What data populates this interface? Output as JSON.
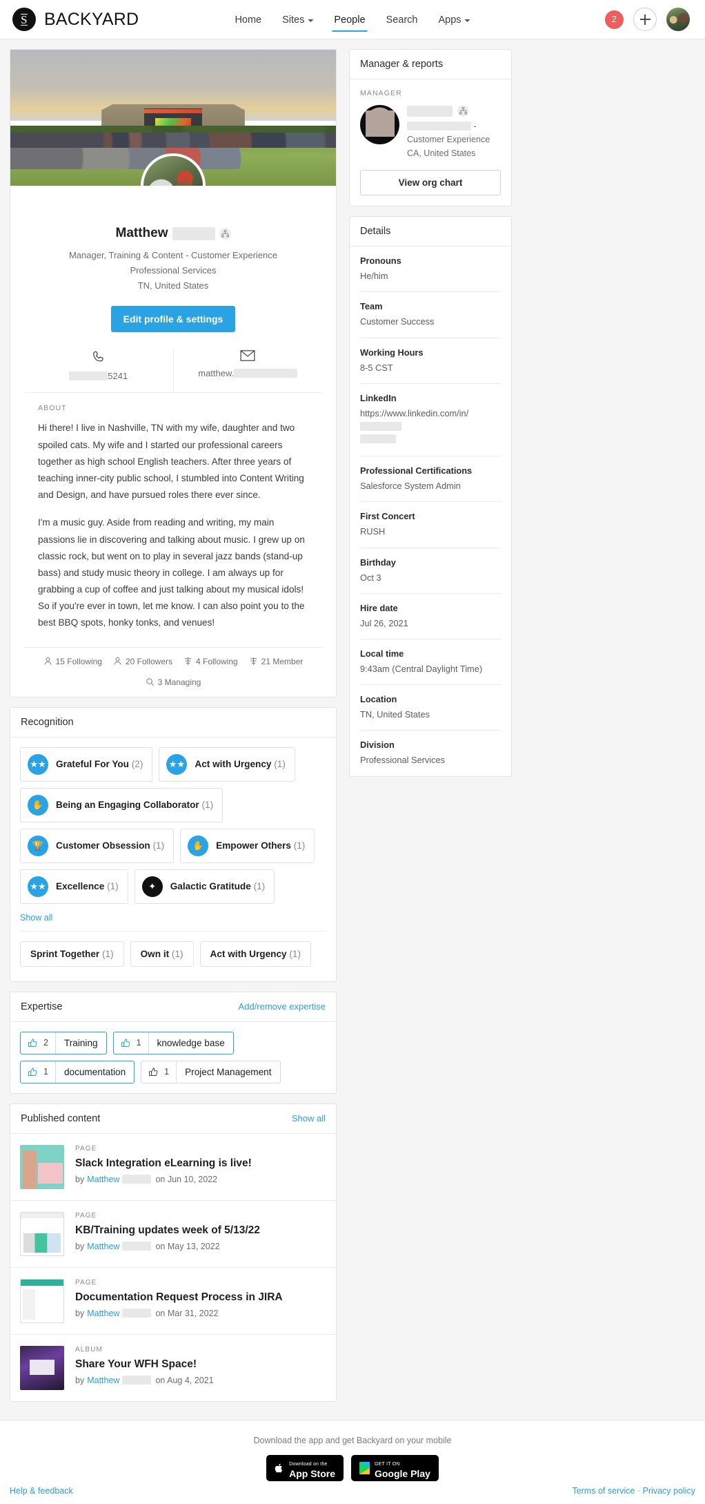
{
  "header": {
    "brand_letter": "S",
    "brand_name": "BACKYARD",
    "nav": [
      {
        "label": "Home",
        "caret": false,
        "active": false
      },
      {
        "label": "Sites",
        "caret": true,
        "active": false
      },
      {
        "label": "People",
        "caret": false,
        "active": true
      },
      {
        "label": "Search",
        "caret": false,
        "active": false
      },
      {
        "label": "Apps",
        "caret": true,
        "active": false
      }
    ],
    "notification_count": "2",
    "create_label": "+",
    "accent_color": "#29a3e3",
    "badge_color": "#ef5e5e"
  },
  "profile": {
    "first_name": "Matthew",
    "title": "Manager, Training & Content - Customer Experience",
    "department": "Professional Services",
    "location": "TN, United States",
    "edit_button": "Edit profile & settings",
    "phone": "5241",
    "email": "matthew.",
    "about_label": "ABOUT",
    "about_p1": "Hi there! I live in Nashville, TN with my wife, daughter and two spoiled cats. My wife and I started our professional careers together as high school English teachers. After three years of teaching inner-city public school, I stumbled into Content Writing and Design, and have pursued roles there ever since.",
    "about_p2": "I'm a music guy. Aside from reading and writing, my main passions lie in discovering and talking about music. I grew up on classic rock, but went on to play in several jazz bands (stand-up bass) and study music theory in college. I am always up for grabbing a cup of coffee and just talking about my musical idols! So if you're ever in town, let me know. I can also point you to the best BBQ spots, honky tonks, and venues!",
    "stats": [
      {
        "icon": "person-icon",
        "label": "15 Following"
      },
      {
        "icon": "person-icon",
        "label": "20 Followers"
      },
      {
        "icon": "site-icon",
        "label": "4 Following"
      },
      {
        "icon": "site-icon",
        "label": "21 Member"
      },
      {
        "icon": "search-icon",
        "label": "3 Managing"
      }
    ]
  },
  "recognition": {
    "title": "Recognition",
    "badges": [
      {
        "label": "Grateful For You",
        "count": "(2)",
        "icon": "stars-icon",
        "style": "blue"
      },
      {
        "label": "Act with Urgency",
        "count": "(1)",
        "icon": "stars-icon",
        "style": "blue"
      },
      {
        "label": "Being an Engaging Collaborator",
        "count": "(1)",
        "icon": "hands-icon",
        "style": "blue"
      },
      {
        "label": "Customer Obsession",
        "count": "(1)",
        "icon": "trophy-icon",
        "style": "blue"
      },
      {
        "label": "Empower Others",
        "count": "(1)",
        "icon": "hands-icon",
        "style": "blue"
      },
      {
        "label": "Excellence",
        "count": "(1)",
        "icon": "stars-icon",
        "style": "blue"
      },
      {
        "label": "Galactic Gratitude",
        "count": "(1)",
        "icon": "starburst-icon",
        "style": "dark"
      }
    ],
    "show_all": "Show all",
    "chips": [
      {
        "label": "Sprint Together",
        "count": "(1)"
      },
      {
        "label": "Own it",
        "count": "(1)"
      },
      {
        "label": "Act with Urgency",
        "count": "(1)"
      }
    ]
  },
  "expertise": {
    "title": "Expertise",
    "action": "Add/remove expertise",
    "items": [
      {
        "count": "2",
        "name": "Training",
        "endorsed": true
      },
      {
        "count": "1",
        "name": "knowledge base",
        "endorsed": true
      },
      {
        "count": "1",
        "name": "documentation",
        "endorsed": true
      },
      {
        "count": "1",
        "name": "Project Management",
        "endorsed": false
      }
    ]
  },
  "published": {
    "title": "Published content",
    "show_all": "Show all",
    "items": [
      {
        "kind": "PAGE",
        "title": "Slack Integration eLearning is live!",
        "by": "by",
        "author": "Matthew",
        "on": "on Jun 10, 2022",
        "thumb": "t1"
      },
      {
        "kind": "PAGE",
        "title": "KB/Training updates week of 5/13/22",
        "by": "by",
        "author": "Matthew",
        "on": "on May 13, 2022",
        "thumb": "t2"
      },
      {
        "kind": "PAGE",
        "title": "Documentation Request Process in JIRA",
        "by": "by",
        "author": "Matthew",
        "on": "on Mar 31, 2022",
        "thumb": "t3"
      },
      {
        "kind": "ALBUM",
        "title": "Share Your WFH Space!",
        "by": "by",
        "author": "Matthew",
        "on": "on Aug 4, 2021",
        "thumb": "t4"
      }
    ]
  },
  "sidebar": {
    "manager_card_title": "Manager & reports",
    "manager_label": "MANAGER",
    "manager_title_suffix": "- Customer Experience",
    "manager_location": "CA, United States",
    "org_chart_button": "View org chart",
    "details_title": "Details",
    "details": [
      {
        "key": "Pronouns",
        "value": "He/him"
      },
      {
        "key": "Team",
        "value": "Customer Success"
      },
      {
        "key": "Working Hours",
        "value": "8-5 CST"
      },
      {
        "key": "LinkedIn",
        "value": "https://www.linkedin.com/in/"
      },
      {
        "key": "Professional Certifications",
        "value": "Salesforce System Admin"
      },
      {
        "key": "First Concert",
        "value": "RUSH"
      },
      {
        "key": "Birthday",
        "value": "Oct 3"
      },
      {
        "key": "Hire date",
        "value": "Jul 26, 2021"
      },
      {
        "key": "Local time",
        "value": "9:43am (Central Daylight Time)"
      },
      {
        "key": "Location",
        "value": "TN, United States"
      },
      {
        "key": "Division",
        "value": "Professional Services"
      }
    ]
  },
  "footer": {
    "tagline": "Download the app and get Backyard on your mobile",
    "app_store_small": "Download on the",
    "app_store_big": "App Store",
    "google_small": "GET IT ON",
    "google_big": "Google Play",
    "help": "Help & feedback",
    "terms": "Terms of service",
    "separator": "·",
    "privacy": "Privacy policy"
  }
}
